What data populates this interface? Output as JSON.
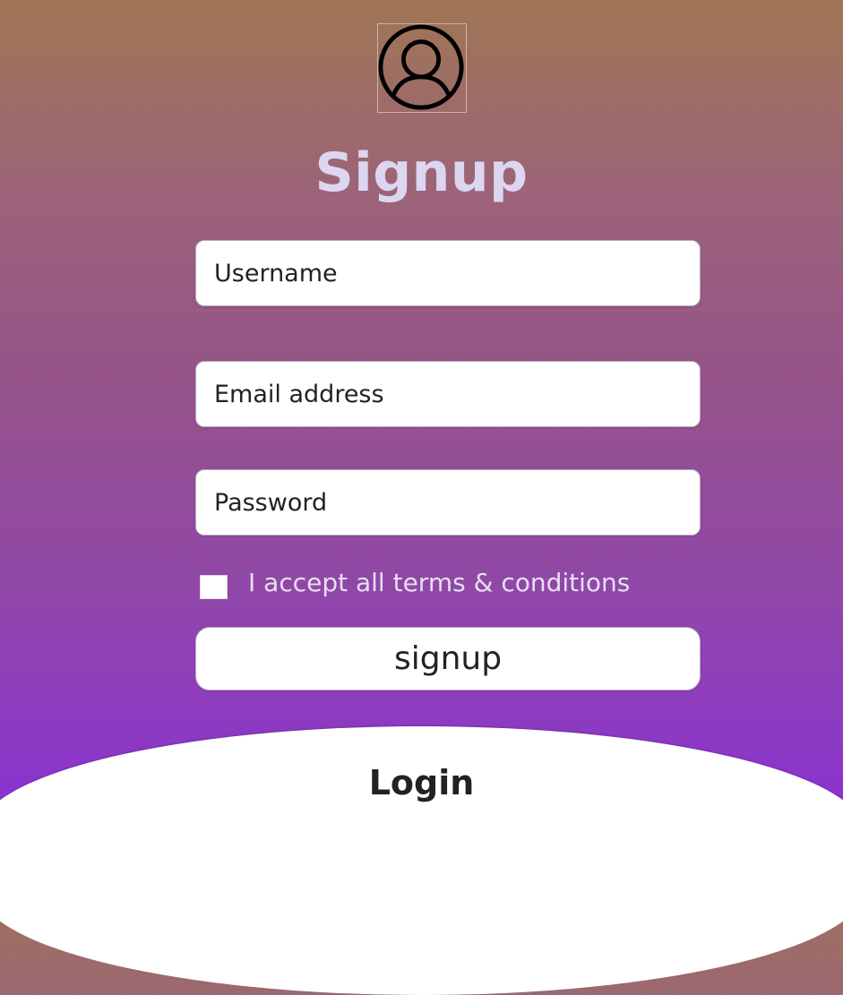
{
  "form": {
    "avatar_icon": "user-circle-icon",
    "title": "Signup",
    "username_placeholder": "Username",
    "email_placeholder": "Email address",
    "password_placeholder": "Password",
    "terms_label": "I accept all terms & conditions",
    "terms_checked": false,
    "submit_label": "signup"
  },
  "footer": {
    "login_label": "Login"
  },
  "colors": {
    "gradient_top": "#a07654",
    "gradient_bottom": "#8a2fd8",
    "title": "#dcd6f0",
    "field_bg": "#ffffff",
    "text": "#222222"
  }
}
